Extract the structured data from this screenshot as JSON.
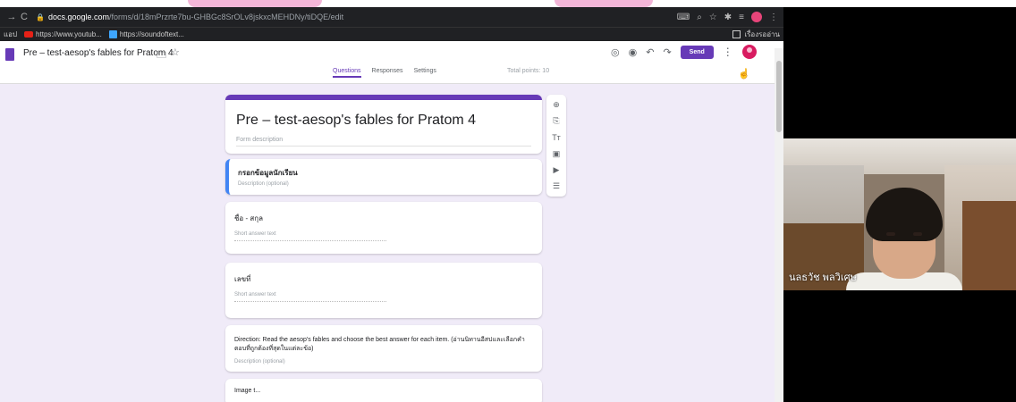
{
  "browser": {
    "url_host": "docs.google.com",
    "url_path": "/forms/d/18mPrzrte7bu-GHBGc8SrOLv8jskxcMEHDNy/tiDQE/edit",
    "bookmarks": [
      {
        "label": "แอป"
      },
      {
        "label": "https://www.youtub..."
      },
      {
        "label": "https://soundoftext..."
      }
    ],
    "reading_list_label": "เรื่องรออ่าน"
  },
  "forms": {
    "doc_title": "Pre – test-aesop's fables for Pratom 4",
    "tabs": [
      {
        "label": "Questions",
        "active": true
      },
      {
        "label": "Responses",
        "active": false
      },
      {
        "label": "Settings",
        "active": false
      }
    ],
    "total_points": "Total points: 10",
    "send_label": "Send",
    "accent_color": "#673ab7"
  },
  "cards": {
    "title": {
      "heading": "Pre – test-aesop's fables for Pratom 4",
      "description": "Form description"
    },
    "section": {
      "heading": "กรอกข้อมูลนักเรียน",
      "description": "Description (optional)"
    },
    "q1": {
      "question": "ชื่อ - สกุล",
      "answer_placeholder": "Short answer text"
    },
    "q2": {
      "question": "เลขที่",
      "answer_placeholder": "Short answer text"
    },
    "direction": {
      "text": "Direction: Read the aesop's fables and choose the best answer for each item. (อ่านนิทานอีสปและเลือกคำตอบที่ถูกต้องที่สุดในแต่ละข้อ)",
      "description": "Description (optional)"
    },
    "image": {
      "label": "Image t..."
    }
  },
  "webcam": {
    "name": "นลธวัช พลวิเศษ"
  }
}
